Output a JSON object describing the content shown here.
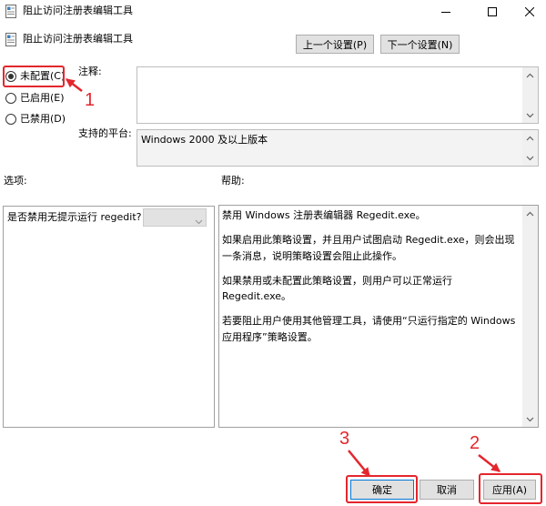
{
  "window": {
    "title": "阻止访问注册表编辑工具",
    "icon": "policy-icon",
    "controls": [
      "minimize-icon",
      "maximize-icon",
      "close-icon"
    ]
  },
  "header": {
    "policy_name": "阻止访问注册表编辑工具",
    "prev_setting_label": "上一个设置(P)",
    "next_setting_label": "下一个设置(N)"
  },
  "state": {
    "selected_index": 0,
    "options": [
      {
        "label": "未配置(C)"
      },
      {
        "label": "已启用(E)"
      },
      {
        "label": "已禁用(D)"
      }
    ]
  },
  "comment": {
    "label": "注释:",
    "value": ""
  },
  "platform": {
    "label": "支持的平台:",
    "value": "Windows 2000 及以上版本"
  },
  "options_panel": {
    "label": "选项:",
    "question": "是否禁用无提示运行 regedit?",
    "dropdown_value": "",
    "dropdown_enabled": false
  },
  "help_panel": {
    "label": "帮助:",
    "paragraphs": [
      "禁用 Windows 注册表编辑器 Regedit.exe。",
      "如果启用此策略设置，并且用户试图启动 Regedit.exe，则会出现一条消息，说明策略设置会阻止此操作。",
      "如果禁用或未配置此策略设置，则用户可以正常运行 Regedit.exe。",
      "若要阻止用户使用其他管理工具，请使用“只运行指定的 Windows 应用程序”策略设置。"
    ]
  },
  "footer": {
    "ok_label": "确定",
    "cancel_label": "取消",
    "apply_label": "应用(A)"
  },
  "annotations": {
    "step_1": "1",
    "step_2": "2",
    "step_3": "3",
    "color": "#e4262d"
  },
  "colors": {
    "button_bg": "#e1e1e1",
    "button_border": "#adadad",
    "default_button_border": "#0078d7",
    "panel_border": "#a0a0a0"
  }
}
